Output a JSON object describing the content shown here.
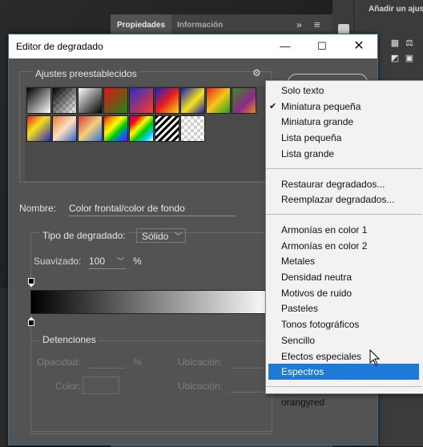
{
  "background": {
    "tabs": [
      {
        "label": "Propiedades"
      },
      {
        "label": "Información"
      }
    ],
    "double_chevron": "»",
    "panel_menu": "≡",
    "ajustes_label": "Añadir un ajuste"
  },
  "dialog": {
    "title": "Editor de degradado",
    "window_controls": {
      "minimize": "—",
      "maximize": "☐",
      "close": "✕"
    },
    "presets_label": "Ajustes preestablecidos",
    "gear": "⚙",
    "name_label": "Nombre:",
    "name_value": "Color frontal/color de fondo",
    "type_label": "Tipo de degradado:",
    "type_value": "Sólido",
    "smooth_label": "Suavizado:",
    "smooth_value": "100",
    "smooth_unit": "%",
    "stops_label": "Detenciones",
    "opacity_label": "Opacidad:",
    "opacity_unit": "%",
    "location_label": "Ubicación:",
    "color_label": "Color:",
    "gradient_start": "#000000",
    "gradient_end": "#ffffff"
  },
  "menu": {
    "items": [
      {
        "label": "Solo texto",
        "checked": false
      },
      {
        "label": "Miniatura pequeña",
        "checked": true
      },
      {
        "label": "Miniatura grande",
        "checked": false
      },
      {
        "label": "Lista pequeña",
        "checked": false
      },
      {
        "label": "Lista grande",
        "checked": false
      },
      {
        "label": "Restaurar degradados...",
        "checked": false
      },
      {
        "label": "Reemplazar degradados...",
        "checked": false
      },
      {
        "label": "Armonías en color 1",
        "checked": false
      },
      {
        "label": "Armonías en color 2",
        "checked": false
      },
      {
        "label": "Metales",
        "checked": false
      },
      {
        "label": "Densidad neutra",
        "checked": false
      },
      {
        "label": "Motivos de ruido",
        "checked": false
      },
      {
        "label": "Pasteles",
        "checked": false
      },
      {
        "label": "Tonos fotográficos",
        "checked": false
      },
      {
        "label": "Sencillo",
        "checked": false
      },
      {
        "label": "Efectos especiales",
        "checked": false
      },
      {
        "label": "Espectros",
        "checked": false,
        "selected": true
      },
      {
        "label": "orangyred",
        "checked": false
      }
    ],
    "check_glyph": "✔",
    "selected_color": "#1e7ad6"
  }
}
